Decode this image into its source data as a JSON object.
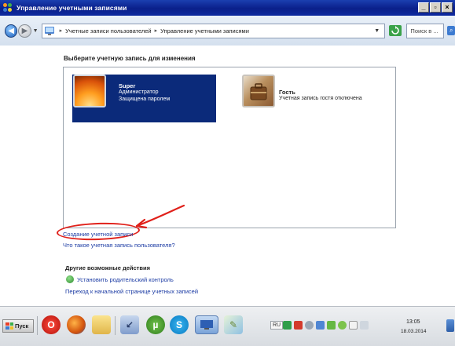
{
  "window": {
    "title": "Управление учетными записями"
  },
  "window_buttons": [
    "_",
    "▫",
    "×"
  ],
  "navbar": {
    "breadcrumb": [
      "Учетные записи пользователей",
      "Управление учетными записями"
    ],
    "search_placeholder": "Поиск в ..."
  },
  "main": {
    "heading": "Выберите учетную запись для изменения",
    "accounts": [
      {
        "name": "Super",
        "lines": [
          "Администратор",
          "Защищена паролем"
        ],
        "selected": true,
        "avatar": "orange-flower-avatar"
      },
      {
        "name": "Гость",
        "lines": [
          "Учетная запись гостя отключена"
        ],
        "selected": false,
        "avatar": "guest-suitcase-avatar"
      }
    ],
    "create_account_link": "Создание учетной записи",
    "what_is_account_link": "Что такое учетная запись пользователя?",
    "other_actions_heading": "Другие возможные действия",
    "parental_control_link": "Установить родительский контроль",
    "go_main_page_link": "Переход к начальной странице учетных записей"
  },
  "taskbar": {
    "start_label": "Пуск",
    "language": "RU",
    "time": "13:05",
    "date": "18.03.2014",
    "apps": [
      "opera-icon",
      "firefox-icon",
      "explorer-folder-icon",
      "unknown-app-icon",
      "utorrent-icon",
      "skype-icon",
      "control-panel-window-icon",
      "paint-icon"
    ]
  },
  "colors": {
    "title_bar": "#0a1f8a",
    "selected_account_bg": "#0b2a7a",
    "link": "#1a3aa3",
    "annotation_red": "#e0201a"
  }
}
